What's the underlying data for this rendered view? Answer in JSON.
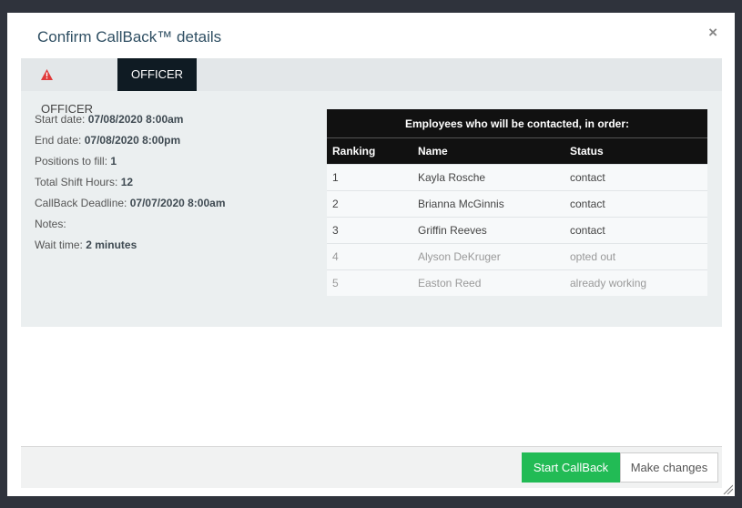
{
  "modal": {
    "title": "Confirm CallBack™ details",
    "close_label": "×"
  },
  "tabs": [
    {
      "label": "OFFICER",
      "icon": "warning-icon",
      "active": false
    },
    {
      "label": "OFFICER",
      "active": true
    }
  ],
  "details": {
    "start_date_label": "Start date:",
    "start_date_value": "07/08/2020 8:00am",
    "end_date_label": "End date:",
    "end_date_value": "07/08/2020 8:00pm",
    "positions_label": "Positions to fill:",
    "positions_value": "1",
    "hours_label": "Total Shift Hours:",
    "hours_value": "12",
    "deadline_label": "CallBack Deadline:",
    "deadline_value": "07/07/2020 8:00am",
    "notes_label": "Notes:",
    "notes_value": "",
    "wait_label": "Wait time:",
    "wait_value": "2 minutes"
  },
  "employees": {
    "caption": "Employees who will be contacted, in order:",
    "headers": [
      "Ranking",
      "Name",
      "Status"
    ],
    "rows": [
      {
        "rank": "1",
        "name": "Kayla Rosche",
        "status": "contact"
      },
      {
        "rank": "2",
        "name": "Brianna McGinnis",
        "status": "contact"
      },
      {
        "rank": "3",
        "name": "Griffin Reeves",
        "status": "contact"
      },
      {
        "rank": "4",
        "name": "Alyson DeKruger",
        "status": "opted out"
      },
      {
        "rank": "5",
        "name": "Easton Reed",
        "status": "already working"
      }
    ]
  },
  "footer": {
    "start_label": "Start CallBack",
    "change_label": "Make changes"
  },
  "colors": {
    "accent_green": "#22bb55",
    "warning_red": "#e03a3a",
    "dark_tab": "#0f1b23"
  }
}
